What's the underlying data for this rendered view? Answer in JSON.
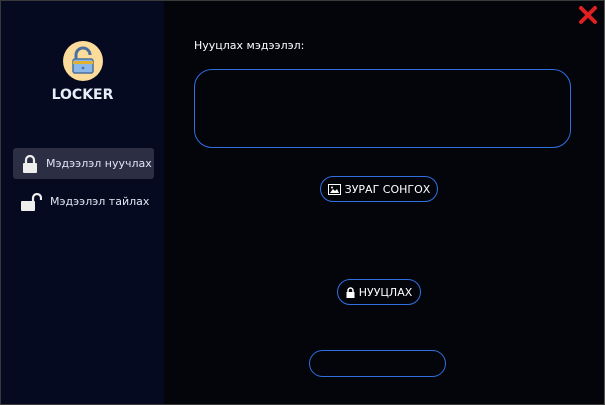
{
  "app": {
    "title": "LOCKER"
  },
  "sidebar": {
    "items": [
      {
        "label": "Мэдээлэл нуучлах",
        "active": true
      },
      {
        "label": "Мэдээлэл тайлах",
        "active": false
      }
    ]
  },
  "main": {
    "message_label": "Нууцлах мэдээлэл:",
    "message_value": "",
    "select_image_label": "ЗУРАГ СОНГОХ",
    "encrypt_label": "НУУЦЛАХ",
    "status_value": ""
  },
  "colors": {
    "accent": "#2f6fe0",
    "close": "#e02020"
  }
}
